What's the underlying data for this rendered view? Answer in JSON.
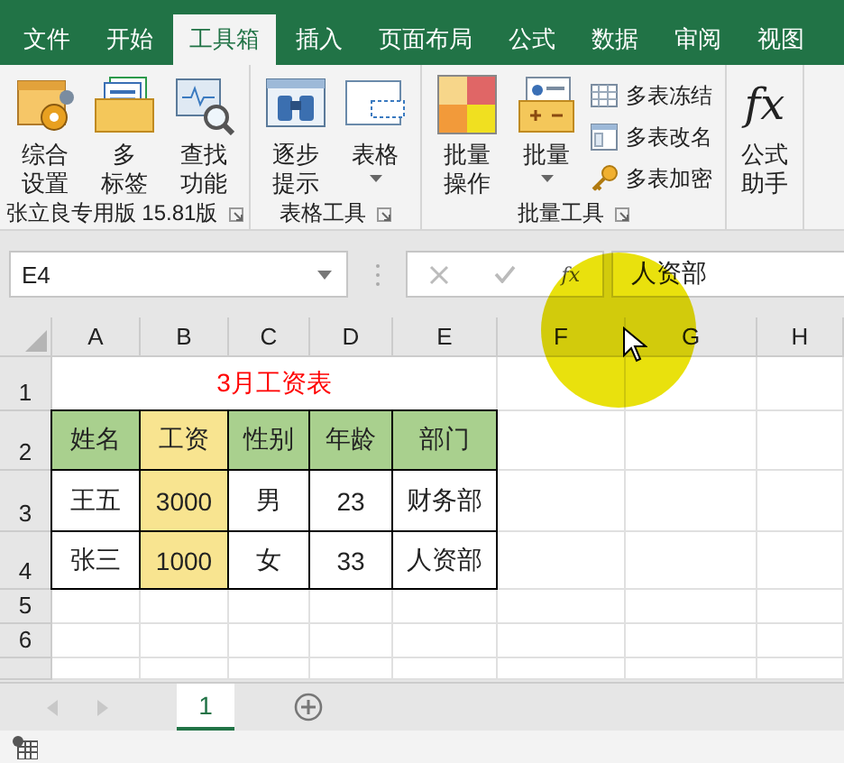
{
  "ribbon_tabs": [
    {
      "label": "文件",
      "selected": false
    },
    {
      "label": "开始",
      "selected": false
    },
    {
      "label": "工具箱",
      "selected": true
    },
    {
      "label": "插入",
      "selected": false
    },
    {
      "label": "页面布局",
      "selected": false
    },
    {
      "label": "公式",
      "selected": false
    },
    {
      "label": "数据",
      "selected": false
    },
    {
      "label": "审阅",
      "selected": false
    },
    {
      "label": "视图",
      "selected": false
    }
  ],
  "ribbon_groups": [
    {
      "label": "张立良专用版 15.81版",
      "launcher": true,
      "buttons": [
        {
          "kind": "large",
          "lines": [
            "综合",
            "设置"
          ]
        },
        {
          "kind": "large",
          "lines": [
            "多",
            "标签"
          ]
        },
        {
          "kind": "large",
          "lines": [
            "查找",
            "功能"
          ]
        }
      ]
    },
    {
      "label": "表格工具",
      "launcher": true,
      "buttons": [
        {
          "kind": "large",
          "lines": [
            "逐步",
            "提示"
          ]
        },
        {
          "kind": "dropdown",
          "lines": [
            "表格"
          ]
        }
      ]
    },
    {
      "label": "批量工具",
      "launcher": true,
      "buttons": [
        {
          "kind": "large",
          "lines": [
            "批量",
            "操作"
          ]
        },
        {
          "kind": "dropdown",
          "lines": [
            "批量"
          ]
        },
        {
          "kind": "small",
          "label": "多表冻结"
        },
        {
          "kind": "small",
          "label": "多表改名"
        },
        {
          "kind": "small",
          "label": "多表加密"
        }
      ]
    },
    {
      "buttons": [
        {
          "kind": "glyph",
          "glyph": "fx",
          "lines": [
            "公式",
            "助手"
          ]
        }
      ]
    }
  ],
  "formula_bar": {
    "name_box": "E4",
    "fx": "fx",
    "value": "人资部"
  },
  "columns": [
    "A",
    "B",
    "C",
    "D",
    "E",
    "F",
    "G",
    "H"
  ],
  "row_headers": [
    "1",
    "2",
    "3",
    "4",
    "5",
    "6"
  ],
  "sheet_title": "3月工资表",
  "table": [
    [
      {
        "text": "姓名",
        "color": "#a9d08e"
      },
      {
        "text": "工资",
        "color": "#f8e490"
      },
      {
        "text": "性别",
        "color": "#a9d08e"
      },
      {
        "text": "年龄",
        "color": "#a9d08e"
      },
      {
        "text": "部门",
        "color": "#a9d08e"
      }
    ],
    [
      {
        "text": "王五",
        "color": "#ffffff"
      },
      {
        "text": "3000",
        "color": "#f8e490"
      },
      {
        "text": "男",
        "color": "#ffffff"
      },
      {
        "text": "23",
        "color": "#ffffff"
      },
      {
        "text": "财务部",
        "color": "#ffffff"
      }
    ],
    [
      {
        "text": "张三",
        "color": "#ffffff"
      },
      {
        "text": "1000",
        "color": "#f8e490"
      },
      {
        "text": "女",
        "color": "#ffffff"
      },
      {
        "text": "33",
        "color": "#ffffff"
      },
      {
        "text": "人资部",
        "color": "#ffffff"
      }
    ]
  ],
  "sheet_tabs": [
    {
      "label": "1",
      "selected": true
    }
  ]
}
